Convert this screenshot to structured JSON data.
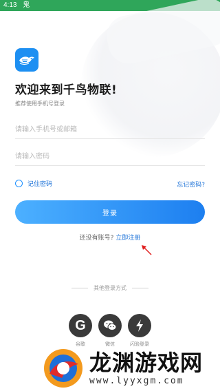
{
  "status_bar": {
    "time": "4:13",
    "app_icon": "鬼"
  },
  "header": {
    "logo_icon": "bird-logo-icon",
    "welcome": "欢迎来到千鸟物联!",
    "subtitle": "推荐使用手机号登录"
  },
  "form": {
    "phone_placeholder": "请输入手机号或邮箱",
    "phone_value": "",
    "password_placeholder": "请输入密码",
    "password_value": "",
    "remember_label": "记住密码",
    "forgot_label": "忘记密码?",
    "login_button": "登录"
  },
  "register": {
    "prompt": "还没有账号? ",
    "link": "立即注册"
  },
  "other_login": {
    "title": "其他登录方式",
    "buttons": [
      {
        "icon": "google-icon",
        "glyph": "G",
        "label": "谷歌"
      },
      {
        "icon": "wechat-icon",
        "label": "微信"
      },
      {
        "icon": "flash-icon",
        "label": "闪验登录"
      }
    ]
  },
  "watermark": {
    "title": "龙渊游戏网",
    "url": "www.lyyxgm.com"
  },
  "colors": {
    "status_bar": "#2fa65a",
    "accent": "#1e73d8",
    "button_start": "#4cb0ff",
    "button_end": "#1d7ff0",
    "social_bg": "#3a3a3a",
    "annotation_arrow": "#e02020"
  }
}
